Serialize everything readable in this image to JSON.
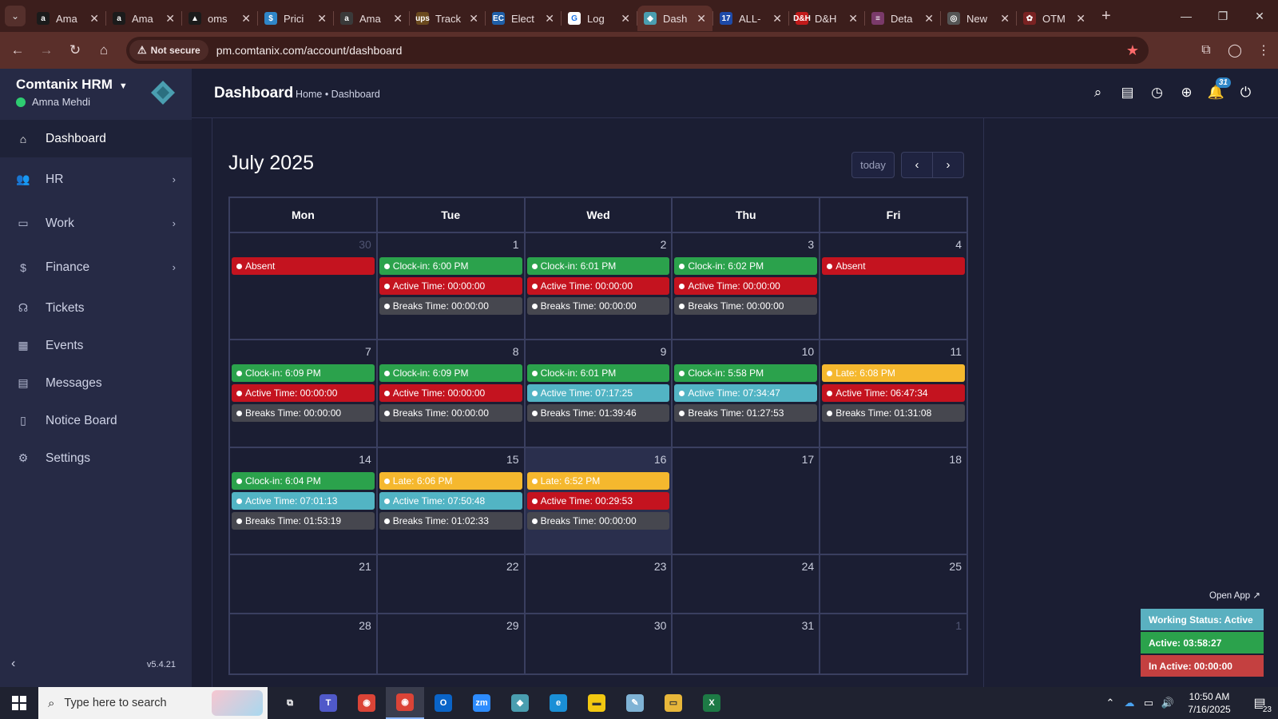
{
  "browser": {
    "tabs": [
      {
        "title": "Ama",
        "fav": "a",
        "favbg": "#1b1b1b",
        "active": false
      },
      {
        "title": "Ama",
        "fav": "a",
        "favbg": "#1b1b1b",
        "active": false
      },
      {
        "title": "oms",
        "fav": "▲",
        "favbg": "#1b1b1b",
        "active": false
      },
      {
        "title": "Prici",
        "fav": "$",
        "favbg": "#2f86c8",
        "active": false
      },
      {
        "title": "Ama",
        "fav": "a",
        "favbg": "#3a3a3a",
        "active": false
      },
      {
        "title": "Track",
        "fav": "ups",
        "favbg": "#6b4a1e",
        "active": false
      },
      {
        "title": "Elect",
        "fav": "EC",
        "favbg": "#1f5fa8",
        "active": false
      },
      {
        "title": "Log",
        "fav": "G",
        "favbg": "#ffffff",
        "active": false
      },
      {
        "title": "Dash",
        "fav": "◆",
        "favbg": "#4a9eb0",
        "active": true
      },
      {
        "title": "ALL-",
        "fav": "17",
        "favbg": "#1e4aa8",
        "active": false
      },
      {
        "title": "D&H",
        "fav": "D&H",
        "favbg": "#c21a1a",
        "active": false
      },
      {
        "title": "Deta",
        "fav": "≡",
        "favbg": "#7a3a6a",
        "active": false
      },
      {
        "title": "New",
        "fav": "◎",
        "favbg": "#555555",
        "active": false
      },
      {
        "title": "OTM",
        "fav": "✿",
        "favbg": "#7a2222",
        "active": false
      }
    ],
    "not_secure": "Not secure",
    "url": "pm.comtanix.com/account/dashboard"
  },
  "sidebar": {
    "brand": "Comtanix HRM",
    "user": "Amna Mehdi",
    "version": "v5.4.21",
    "items": [
      {
        "label": "Dashboard",
        "icon": "home-icon",
        "glyph": "⌂",
        "chevron": false,
        "active": true
      },
      {
        "label": "HR",
        "icon": "users-icon",
        "glyph": "👥",
        "chevron": true,
        "active": false
      },
      {
        "label": "Work",
        "icon": "briefcase-icon",
        "glyph": "▭",
        "chevron": true,
        "active": false
      },
      {
        "label": "Finance",
        "icon": "dollar-icon",
        "glyph": "$",
        "chevron": true,
        "active": false
      },
      {
        "label": "Tickets",
        "icon": "headset-icon",
        "glyph": "☊",
        "chevron": false,
        "active": false
      },
      {
        "label": "Events",
        "icon": "calendar-icon",
        "glyph": "▦",
        "chevron": false,
        "active": false
      },
      {
        "label": "Messages",
        "icon": "message-icon",
        "glyph": "▤",
        "chevron": false,
        "active": false
      },
      {
        "label": "Notice Board",
        "icon": "clipboard-icon",
        "glyph": "▯",
        "chevron": false,
        "active": false
      },
      {
        "label": "Settings",
        "icon": "gear-icon",
        "glyph": "⚙",
        "chevron": false,
        "active": false
      }
    ]
  },
  "header": {
    "title": "Dashboard",
    "breadcrumb": "Home • Dashboard",
    "notification_count": "31"
  },
  "calendar": {
    "title": "July 2025",
    "today_label": "today",
    "days_of_week": [
      "Mon",
      "Tue",
      "Wed",
      "Thu",
      "Fri"
    ],
    "weeks": [
      [
        {
          "day": "30",
          "muted": true,
          "events": [
            {
              "text": "Absent",
              "color": "red"
            }
          ]
        },
        {
          "day": "1",
          "events": [
            {
              "text": "Clock-in: 6:00 PM",
              "color": "green"
            },
            {
              "text": "Active Time: 00:00:00",
              "color": "red"
            },
            {
              "text": "Breaks Time: 00:00:00",
              "color": "gray"
            }
          ]
        },
        {
          "day": "2",
          "events": [
            {
              "text": "Clock-in: 6:01 PM",
              "color": "green"
            },
            {
              "text": "Active Time: 00:00:00",
              "color": "red"
            },
            {
              "text": "Breaks Time: 00:00:00",
              "color": "gray"
            }
          ]
        },
        {
          "day": "3",
          "events": [
            {
              "text": "Clock-in: 6:02 PM",
              "color": "green"
            },
            {
              "text": "Active Time: 00:00:00",
              "color": "red"
            },
            {
              "text": "Breaks Time: 00:00:00",
              "color": "gray"
            }
          ]
        },
        {
          "day": "4",
          "events": [
            {
              "text": "Absent",
              "color": "red"
            }
          ]
        }
      ],
      [
        {
          "day": "7",
          "events": [
            {
              "text": "Clock-in: 6:09 PM",
              "color": "green"
            },
            {
              "text": "Active Time: 00:00:00",
              "color": "red"
            },
            {
              "text": "Breaks Time: 00:00:00",
              "color": "gray"
            }
          ]
        },
        {
          "day": "8",
          "events": [
            {
              "text": "Clock-in: 6:09 PM",
              "color": "green"
            },
            {
              "text": "Active Time: 00:00:00",
              "color": "red"
            },
            {
              "text": "Breaks Time: 00:00:00",
              "color": "gray"
            }
          ]
        },
        {
          "day": "9",
          "events": [
            {
              "text": "Clock-in: 6:01 PM",
              "color": "green"
            },
            {
              "text": "Active Time: 07:17:25",
              "color": "teal"
            },
            {
              "text": "Breaks Time: 01:39:46",
              "color": "gray"
            }
          ]
        },
        {
          "day": "10",
          "events": [
            {
              "text": "Clock-in: 5:58 PM",
              "color": "green"
            },
            {
              "text": "Active Time: 07:34:47",
              "color": "teal"
            },
            {
              "text": "Breaks Time: 01:27:53",
              "color": "gray"
            }
          ]
        },
        {
          "day": "11",
          "events": [
            {
              "text": "Late: 6:08 PM",
              "color": "yellow"
            },
            {
              "text": "Active Time: 06:47:34",
              "color": "red"
            },
            {
              "text": "Breaks Time: 01:31:08",
              "color": "gray"
            }
          ]
        }
      ],
      [
        {
          "day": "14",
          "events": [
            {
              "text": "Clock-in: 6:04 PM",
              "color": "green"
            },
            {
              "text": "Active Time: 07:01:13",
              "color": "teal"
            },
            {
              "text": "Breaks Time: 01:53:19",
              "color": "gray"
            }
          ]
        },
        {
          "day": "15",
          "events": [
            {
              "text": "Late: 6:06 PM",
              "color": "yellow"
            },
            {
              "text": "Active Time: 07:50:48",
              "color": "teal"
            },
            {
              "text": "Breaks Time: 01:02:33",
              "color": "gray"
            }
          ]
        },
        {
          "day": "16",
          "today": true,
          "events": [
            {
              "text": "Late: 6:52 PM",
              "color": "yellow"
            },
            {
              "text": "Active Time: 00:29:53",
              "color": "red"
            },
            {
              "text": "Breaks Time: 00:00:00",
              "color": "gray"
            }
          ]
        },
        {
          "day": "17",
          "events": []
        },
        {
          "day": "18",
          "events": []
        }
      ],
      [
        {
          "day": "21",
          "events": []
        },
        {
          "day": "22",
          "events": []
        },
        {
          "day": "23",
          "events": []
        },
        {
          "day": "24",
          "events": []
        },
        {
          "day": "25",
          "events": []
        }
      ],
      [
        {
          "day": "28",
          "events": []
        },
        {
          "day": "29",
          "events": []
        },
        {
          "day": "30",
          "events": []
        },
        {
          "day": "31",
          "events": []
        },
        {
          "day": "1",
          "muted": true,
          "events": []
        }
      ]
    ]
  },
  "widget": {
    "open_app": "Open App ↗",
    "working_status": "Working Status: Active",
    "active": "Active: 03:58:27",
    "inactive": "In Active: 00:00:00",
    "colors": {
      "status": "#5ab0c0",
      "active": "#2ba24c",
      "inactive": "#c44040"
    }
  },
  "taskbar": {
    "search_placeholder": "Type here to search",
    "time": "10:50 AM",
    "date": "7/16/2025",
    "notifications": "23",
    "apps": [
      {
        "name": "task-view-icon",
        "glyph": "⧉",
        "bg": "transparent"
      },
      {
        "name": "teams-icon",
        "glyph": "T",
        "bg": "#5059c9"
      },
      {
        "name": "chrome-icon",
        "glyph": "◉",
        "bg": "#db4437"
      },
      {
        "name": "chrome-profile-icon",
        "glyph": "◉",
        "bg": "#db4437",
        "active": true
      },
      {
        "name": "outlook-icon",
        "glyph": "O",
        "bg": "#0a64c8"
      },
      {
        "name": "zoom-icon",
        "glyph": "zm",
        "bg": "#2d8cff"
      },
      {
        "name": "comtanix-icon",
        "glyph": "◆",
        "bg": "#4a9eb0"
      },
      {
        "name": "edge-icon",
        "glyph": "e",
        "bg": "#1a8fd6"
      },
      {
        "name": "sticky-notes-icon",
        "glyph": "▬",
        "bg": "#f2c811"
      },
      {
        "name": "notepad-icon",
        "glyph": "✎",
        "bg": "#7fb3d5"
      },
      {
        "name": "file-explorer-icon",
        "glyph": "▭",
        "bg": "#e8b73a"
      },
      {
        "name": "excel-icon",
        "glyph": "X",
        "bg": "#1d7a45"
      }
    ]
  }
}
